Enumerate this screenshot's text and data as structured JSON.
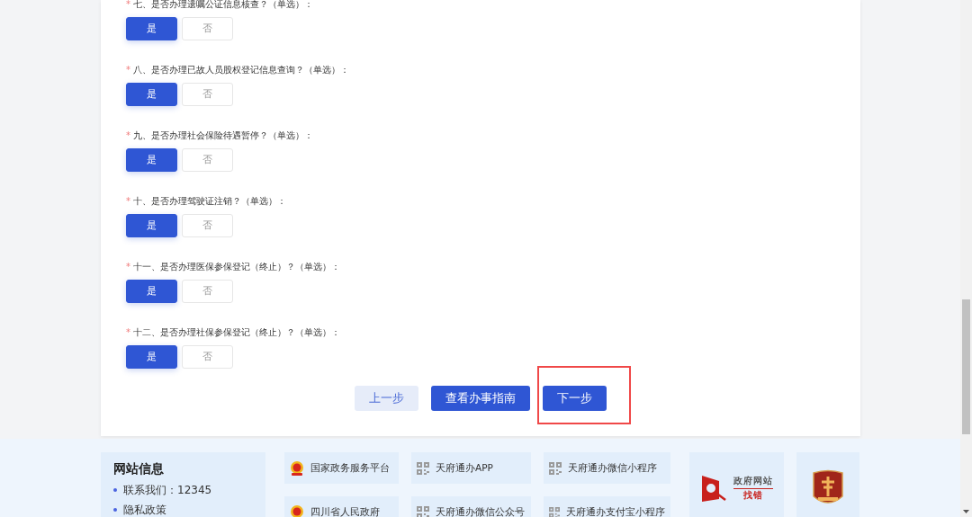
{
  "questions": [
    {
      "label": "七、是否办理遗嘱公证信息核查？（单选）：",
      "marker": "*",
      "options": [
        {
          "label": "是",
          "selected": true
        },
        {
          "label": "否",
          "selected": false
        }
      ]
    },
    {
      "label": "八、是否办理已故人员股权登记信息查询？（单选）：",
      "marker": "*",
      "options": [
        {
          "label": "是",
          "selected": true
        },
        {
          "label": "否",
          "selected": false
        }
      ]
    },
    {
      "label": "九、是否办理社会保险待遇暂停？（单选）：",
      "marker": "*",
      "options": [
        {
          "label": "是",
          "selected": true
        },
        {
          "label": "否",
          "selected": false
        }
      ]
    },
    {
      "label": "十、是否办理驾驶证注销？（单选）：",
      "marker": "*",
      "options": [
        {
          "label": "是",
          "selected": true
        },
        {
          "label": "否",
          "selected": false
        }
      ]
    },
    {
      "label": "十一、是否办理医保参保登记（终止）？（单选）：",
      "marker": "*",
      "options": [
        {
          "label": "是",
          "selected": true
        },
        {
          "label": "否",
          "selected": false
        }
      ]
    },
    {
      "label": "十二、是否办理社保参保登记（终止）？（单选）：",
      "marker": "*",
      "options": [
        {
          "label": "是",
          "selected": true
        },
        {
          "label": "否",
          "selected": false
        }
      ]
    }
  ],
  "actions": [
    {
      "label": "上一步",
      "kind": "secondary",
      "highlighted": false
    },
    {
      "label": "查看办事指南",
      "kind": "primary",
      "highlighted": false
    },
    {
      "label": "下一步",
      "kind": "primary",
      "highlighted": true
    }
  ],
  "footer": {
    "site_info": {
      "title": "网站信息",
      "items": [
        "联系我们：12345",
        "隐私政策"
      ]
    },
    "links": [
      {
        "label": "国家政务服务平台",
        "kind": "emblem"
      },
      {
        "label": "天府通办APP",
        "kind": "qr"
      },
      {
        "label": "天府通办微信小程序",
        "kind": "qr"
      },
      {
        "label": "四川省人民政府",
        "kind": "emblem"
      },
      {
        "label": "天府通办微信公众号",
        "kind": "qr"
      },
      {
        "label": "天府通办支付宝小程序",
        "kind": "qr"
      }
    ],
    "badges": [
      {
        "kind": "error-report",
        "lines": [
          "政府网站",
          "找错"
        ]
      },
      {
        "kind": "shield"
      }
    ]
  }
}
